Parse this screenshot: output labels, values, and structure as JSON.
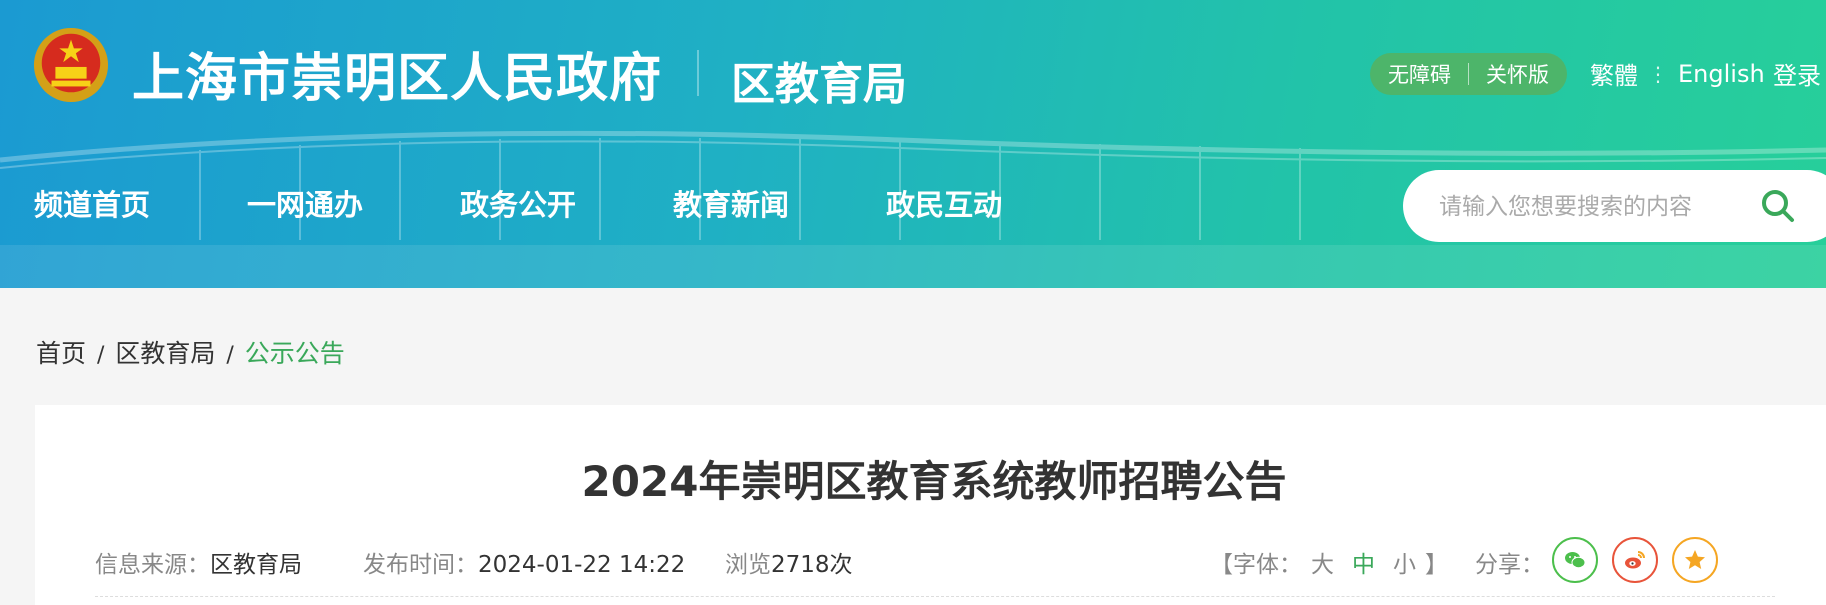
{
  "header": {
    "site_title": "上海市崇明区人民政府",
    "department": "区教育局",
    "accessibility": {
      "barrier_free": "无障碍",
      "care_mode": "关怀版"
    },
    "language": {
      "traditional": "繁體",
      "english": "English"
    },
    "login": "登录",
    "nav": [
      {
        "label": "频道首页"
      },
      {
        "label": "一网通办"
      },
      {
        "label": "政务公开"
      },
      {
        "label": "教育新闻"
      },
      {
        "label": "政民互动"
      }
    ],
    "search": {
      "placeholder": "请输入您想要搜索的内容"
    }
  },
  "breadcrumb": {
    "home": "首页",
    "section": "区教育局",
    "current": "公示公告"
  },
  "article": {
    "title": "2024年崇明区教育系统教师招聘公告",
    "source_label": "信息来源：",
    "source": "区教育局",
    "date_label": "发布时间：",
    "date": "2024-01-22 14:22",
    "views_label": "浏览",
    "views": "2718",
    "views_suffix": "次",
    "font_size": {
      "label": "【字体：",
      "large": "大",
      "medium": "中",
      "small": "小",
      "close": "】"
    },
    "share_label": "分享：",
    "share_icons": [
      "wechat-icon",
      "weibo-icon",
      "favorite-icon"
    ]
  },
  "colors": {
    "accent_green": "#3aa85a",
    "access_bg": "#4db56a",
    "header_start": "#1b9ad2",
    "header_end": "#27cf9a"
  }
}
